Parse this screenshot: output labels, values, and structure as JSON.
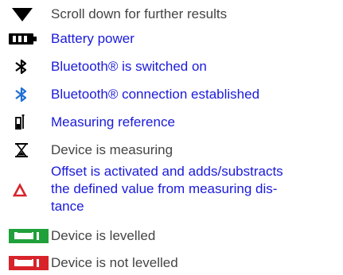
{
  "colors": {
    "link_text": "#1a1adb",
    "plain_text": "#444444",
    "icon_black": "#000000",
    "bluetooth_connected": "#1f6fd6",
    "offset_red": "#d8232a",
    "level_green": "#1fa03a",
    "not_level_red": "#d8232a"
  },
  "items": [
    {
      "icon": "triangle-down-icon",
      "text": "Scroll down for further results"
    },
    {
      "icon": "battery-icon",
      "text": "Battery power"
    },
    {
      "icon": "bluetooth-icon",
      "text": "Bluetooth® is switched on"
    },
    {
      "icon": "bluetooth-connected-icon",
      "text": "Bluetooth® connection established"
    },
    {
      "icon": "measuring-reference-icon",
      "text": "Measuring reference"
    },
    {
      "icon": "hourglass-icon",
      "text": "Device is measuring"
    },
    {
      "icon": "offset-triangle-icon",
      "text_lines": [
        "Offset is activated and adds/substracts",
        "the defined value from measuring dis-",
        "tance"
      ]
    },
    {
      "icon": "level-green-icon",
      "text": "Device is levelled"
    },
    {
      "icon": "level-red-icon",
      "text": "Device is not levelled"
    }
  ]
}
